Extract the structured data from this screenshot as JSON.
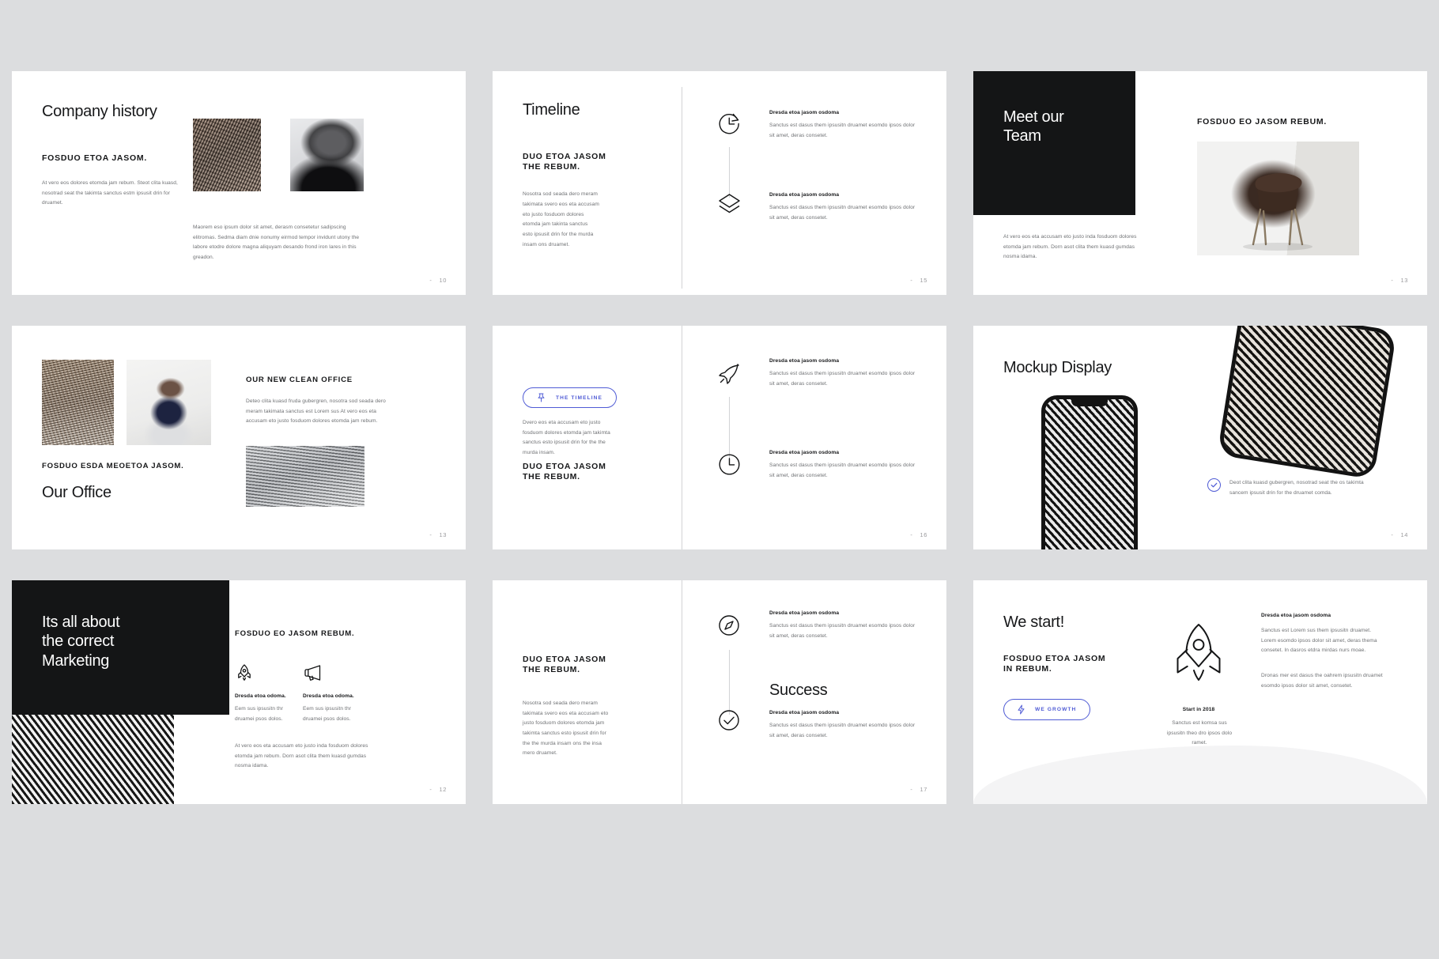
{
  "deck": {
    "background_color": "#dcdddf",
    "slide_background": "#ffffff",
    "accent_color": "#4f5bd5",
    "dark_color": "#141516"
  },
  "slides": [
    {
      "id": "company-history",
      "title": "Company history",
      "subtitle": "FOSDUO ETOA JASOM.",
      "body": "At vero eos dolores etomda jam rebum. Steot clita kuasd, nosotrad seat the takimta sanctus estm ipsusit drin for druamet.",
      "paragraph": "Maorem eso ipsum dolor sit amet, derasm consetetur sadipscing elitromas. Sedma diam dnie nonumy eirmod tempor invidunt utony the labore etodre dolore magna aliquyam desando frond iron lares in this greadon.",
      "page": "10"
    },
    {
      "id": "timeline",
      "title": "Timeline",
      "subtitle": "DUO ETOA JASOM\nTHE REBUM.",
      "body": "Nosotra sod seada dero meram takimata svero eos eta accusam eto justo fosduom dolores etomda jam takinta sanctus esto ipsusit drin for the murda insam ons druamet.",
      "page": "15",
      "entries": [
        {
          "icon": "clock-arrow-icon",
          "heading": "Dresda etoa jasom osdoma",
          "text": "Sanctus est dasus them ipsusitn druamet esomdo ipsos dolor sit amet, deras consetet."
        },
        {
          "icon": "layers-icon",
          "heading": "Dresda etoa jasom osdoma",
          "text": "Sanctus est dasus them ipsusitn druamet esomdo ipsos dolor sit amet, deras consetet."
        }
      ]
    },
    {
      "id": "meet-our-team",
      "title": "Meet our\nTeam",
      "subtitle": "FOSDUO EO JASOM REBUM.",
      "body": "At vero eos eta accusam eto justo inda fosduom dolores etomda jam rebum. Dorn asot clita them kuasd gumdas nosma idama.",
      "page": "13"
    },
    {
      "id": "our-office",
      "title": "Our Office",
      "subtitle": "FOSDUO ESDA MEOETOA JASOM.",
      "side_heading": "OUR NEW CLEAN OFFICE",
      "side_body": "Deteo clita kuasd fruda gubergren, nosotra sod seada dero meram takimata sanctus est Lorem sus At vero eos eta accusam eto justo fosduom dolores etomda jam rebum.",
      "page": "13"
    },
    {
      "id": "the-timeline",
      "pill_label": "THE TIMELINE",
      "pill_icon": "pin-icon",
      "body": "Dvero eos eta accusam eto justo fosduom dolores etomda jam takimta sanctus esto ipsusit drin for the the murda insam.",
      "subtitle": "DUO ETOA JASOM\nTHE REBUM.",
      "page": "16",
      "entries": [
        {
          "icon": "rocket-send-icon",
          "heading": "Dresda etoa jasom osdoma",
          "text": "Sanctus est dasus them ipsusitn druamet esomdo ipsos dolor sit amet, deras consetet."
        },
        {
          "icon": "clock-icon",
          "heading": "Dresda etoa jasom osdoma",
          "text": "Sanctus est dasus them ipsusitn druamet esomdo ipsos dolor sit amet, deras consetet."
        }
      ]
    },
    {
      "id": "mockup-display",
      "title": "Mockup Display",
      "caption": "Deot clita kuasd gubergren, nosotrad seat the os takimta sancem ipsusit drin for the druamet comda.",
      "caption_icon": "check-circle-icon",
      "page": "14"
    },
    {
      "id": "marketing",
      "title": "Its all about\nthe correct\nMarketing",
      "subtitle": "FOSDUO EO JASOM REBUM.",
      "page": "12",
      "features": [
        {
          "icon": "rocket-icon",
          "heading": "Dresda etoa odoma.",
          "text": "Eem sus  ipsusitn thr druamei psos dolos."
        },
        {
          "icon": "megaphone-icon",
          "heading": "Dresda etoa odoma.",
          "text": "Eem sus  ipsusitn thr druamei psos dolos."
        }
      ],
      "footer_body": "At vero eos eta accusam eto justo inda fosduom dolores etomda jam rebum. Dorn asot clita them kuasd gumdas nosma idama."
    },
    {
      "id": "success",
      "subtitle": "DUO ETOA JASOM\nTHE REBUM.",
      "body": "Nosotra sod seada dero meram takimata svero eos eta accusam eto justo fosduom dolores etomda jam takimta sanctus esto ipsusit drin for the the murda insam ons the insa mero druamet.",
      "title": "Success",
      "page": "17",
      "entries": [
        {
          "icon": "compass-icon",
          "heading": "Dresda etoa jasom osdoma",
          "text": "Sanctus est dasus them ipsusitn druamet esomdo ipsos dolor sit amet, deras consetet."
        },
        {
          "icon": "check-circle-icon",
          "heading": "Dresda etoa jasom osdoma",
          "text": "Sanctus est dasus them ipsusitn druamet esomdo ipsos dolor sit amet, deras consetet."
        }
      ]
    },
    {
      "id": "we-start",
      "title": "We start!",
      "subtitle": "FOSDUO ETOA JASOM\nIN REBUM.",
      "pill_label": "WE GROWTH",
      "pill_icon": "bolt-icon",
      "rocket_icon": "rocket-icon",
      "rocket_heading": "Start in 2018",
      "rocket_text": "Sanctus est komsa sus ipsusitn theo dro ipsos dolo ramet.",
      "right_heading": "Dresda etoa jasom osdoma",
      "right_body_1": "Sanctus est Lorem sus them ipsusitn druamet. Lorem esomdo ipsos dolor sit amet, deras thema consetet. In dasros etdra mirdas nurs moae.",
      "right_body_2": "Dronas mer est dasus the oahrem ipsusitn druamet esomdo ipsos dolor sit amet, consetet."
    }
  ]
}
